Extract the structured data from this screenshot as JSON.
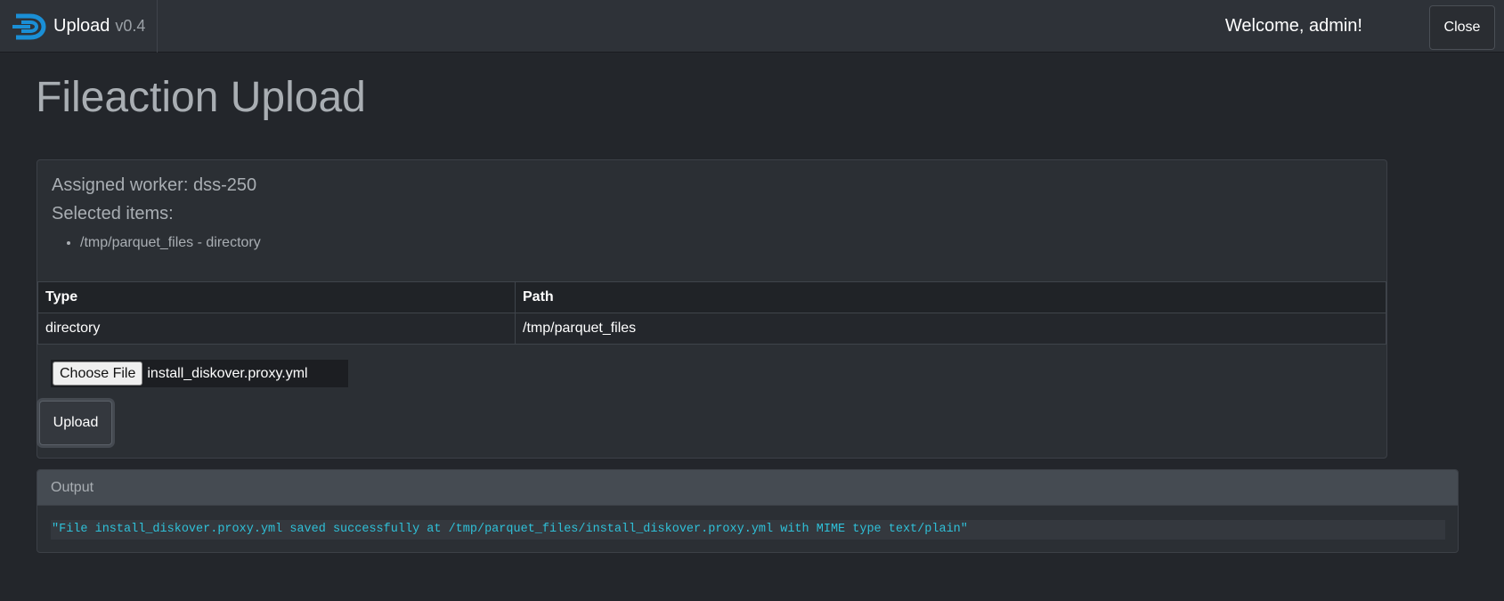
{
  "navbar": {
    "app_name": "Upload",
    "version": "v0.4",
    "welcome": "Welcome, admin!",
    "close_label": "Close"
  },
  "page": {
    "title": "Fileaction Upload"
  },
  "card": {
    "assigned_worker": "Assigned worker: dss-250",
    "selected_label": "Selected items:",
    "selected_items": [
      "/tmp/parquet_files - directory"
    ],
    "table": {
      "headers": [
        "Type",
        "Path"
      ],
      "rows": [
        [
          "directory",
          "/tmp/parquet_files"
        ]
      ]
    },
    "file_input": {
      "button_label": "Choose File",
      "file_name": "install_diskover.proxy.yml"
    },
    "upload_label": "Upload"
  },
  "output": {
    "header": "Output",
    "text": "\"File install_diskover.proxy.yml saved successfully at /tmp/parquet_files/install_diskover.proxy.yml with MIME type text/plain\""
  },
  "colors": {
    "background": "#23262b",
    "navbar": "#2e3238",
    "output_text": "#2fc0d8",
    "logo_blue": "#1a8fd6"
  }
}
